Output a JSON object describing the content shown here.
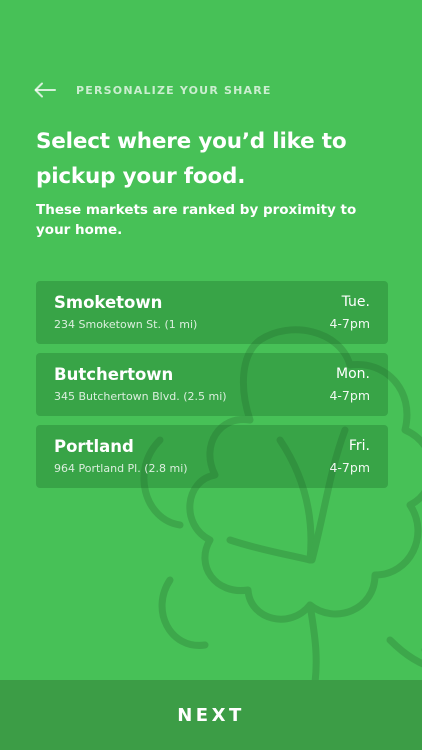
{
  "header": {
    "back_icon": "arrow-left-icon",
    "title": "PERSONALIZE YOUR SHARE"
  },
  "main": {
    "title": "Select where you’d like to pickup your food.",
    "subtitle": "These markets are ranked by proximity to your home."
  },
  "markets": [
    {
      "name": "Smoketown",
      "address": "234 Smoketown St. (1 mi)",
      "day": "Tue.",
      "time": "4-7pm"
    },
    {
      "name": "Butchertown",
      "address": "345 Butchertown Blvd. (2.5 mi)",
      "day": "Mon.",
      "time": "4-7pm"
    },
    {
      "name": "Portland",
      "address": "964 Portland Pl. (2.8 mi)",
      "day": "Fri.",
      "time": "4-7pm"
    }
  ],
  "footer": {
    "next_label": "NEXT"
  },
  "colors": {
    "background": "#47c157",
    "card": "#3a9c46",
    "footer_button": "#3c9d46",
    "text": "#ffffff"
  }
}
